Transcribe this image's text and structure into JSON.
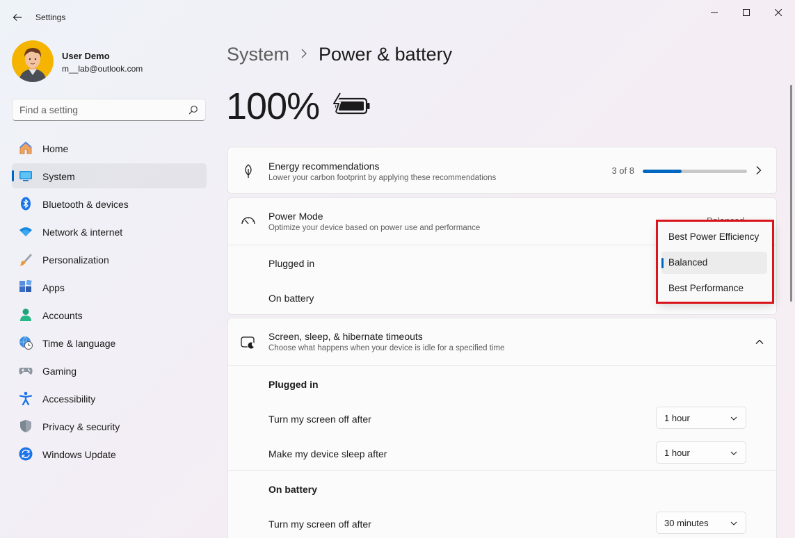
{
  "window": {
    "title": "Settings",
    "controls": {
      "minimize": "minimize",
      "maximize": "maximize",
      "close": "close"
    }
  },
  "profile": {
    "name": "User Demo",
    "email": "m__lab@outlook.com"
  },
  "search": {
    "placeholder": "Find a setting"
  },
  "sidebar": {
    "items": [
      {
        "label": "Home",
        "icon": "home-icon"
      },
      {
        "label": "System",
        "icon": "system-icon",
        "selected": true
      },
      {
        "label": "Bluetooth & devices",
        "icon": "bluetooth-icon"
      },
      {
        "label": "Network & internet",
        "icon": "wifi-icon"
      },
      {
        "label": "Personalization",
        "icon": "brush-icon"
      },
      {
        "label": "Apps",
        "icon": "apps-icon"
      },
      {
        "label": "Accounts",
        "icon": "person-icon"
      },
      {
        "label": "Time & language",
        "icon": "globe-clock-icon"
      },
      {
        "label": "Gaming",
        "icon": "gamepad-icon"
      },
      {
        "label": "Accessibility",
        "icon": "accessibility-icon"
      },
      {
        "label": "Privacy & security",
        "icon": "shield-icon"
      },
      {
        "label": "Windows Update",
        "icon": "update-icon"
      }
    ]
  },
  "breadcrumb": {
    "parent": "System",
    "separator": ">",
    "current": "Power & battery"
  },
  "battery": {
    "percent": "100%",
    "level": 1.0,
    "charging": true
  },
  "energy": {
    "title": "Energy recommendations",
    "subtitle": "Lower your carbon footprint by applying these recommendations",
    "progress_text": "3 of 8",
    "progress_fraction": 0.375
  },
  "power_mode": {
    "title": "Power Mode",
    "subtitle": "Optimize your device based on power use and performance",
    "behind_value": "Balanced",
    "rows": {
      "plugged_in": "Plugged in",
      "on_battery": "On battery"
    },
    "flyout": {
      "options": [
        "Best Power Efficiency",
        "Balanced",
        "Best Performance"
      ],
      "selected_index": 1
    }
  },
  "screen_sleep": {
    "title": "Screen, sleep, & hibernate timeouts",
    "subtitle": "Choose what happens when your device is idle for a specified time",
    "plugged_in_heading": "Plugged in",
    "on_battery_heading": "On battery",
    "plugged_screen_label": "Turn my screen off after",
    "plugged_screen_value": "1 hour",
    "plugged_sleep_label": "Make my device sleep after",
    "plugged_sleep_value": "1 hour",
    "battery_screen_label": "Turn my screen off after",
    "battery_screen_value": "30 minutes"
  },
  "colors": {
    "accent": "#0067c0",
    "highlight": "#d9141b"
  }
}
